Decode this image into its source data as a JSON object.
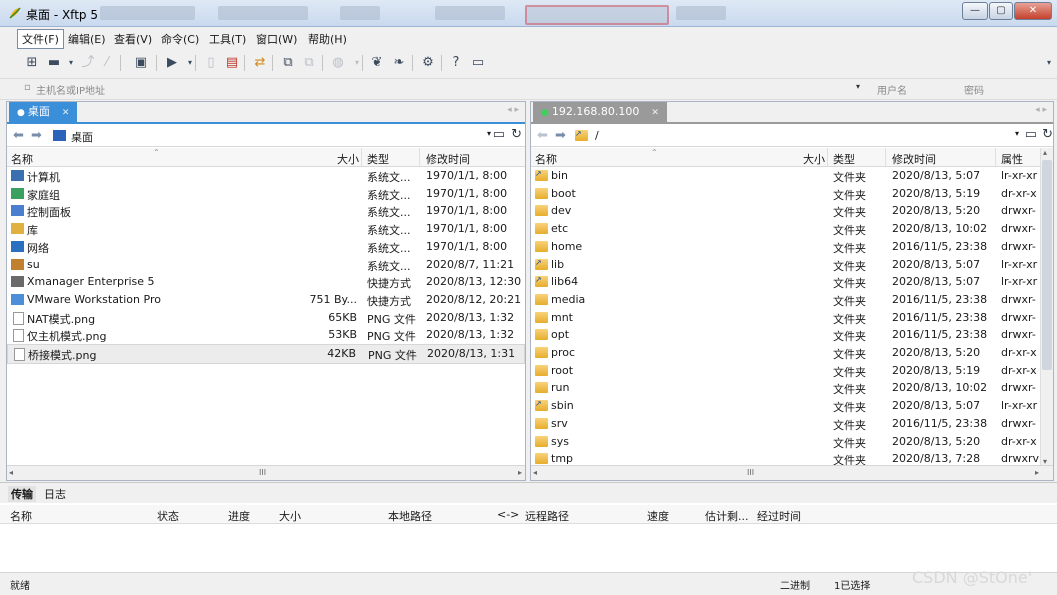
{
  "window": {
    "title": "桌面 - Xftp 5",
    "minimize": "—",
    "maximize": "▢",
    "close": "✕"
  },
  "menu": [
    "文件(F)",
    "编辑(E)",
    "查看(V)",
    "命令(C)",
    "工具(T)",
    "窗口(W)",
    "帮助(H)"
  ],
  "address": {
    "host_placeholder": "主机名或IP地址",
    "user_placeholder": "用户名",
    "password_placeholder": "密码"
  },
  "left_pane": {
    "tab_label": "桌面",
    "path": "桌面",
    "columns": {
      "name": "名称",
      "size": "大小",
      "type": "类型",
      "modified": "修改时间"
    },
    "rows": [
      {
        "name": "计算机",
        "size": "",
        "type": "系统文...",
        "modified": "1970/1/1, 8:00",
        "icon": "computer-icon"
      },
      {
        "name": "家庭组",
        "size": "",
        "type": "系统文...",
        "modified": "1970/1/1, 8:00",
        "icon": "homegroup-icon"
      },
      {
        "name": "控制面板",
        "size": "",
        "type": "系统文...",
        "modified": "1970/1/1, 8:00",
        "icon": "control-panel-icon"
      },
      {
        "name": "库",
        "size": "",
        "type": "系统文...",
        "modified": "1970/1/1, 8:00",
        "icon": "library-icon"
      },
      {
        "name": "网络",
        "size": "",
        "type": "系统文...",
        "modified": "1970/1/1, 8:00",
        "icon": "network-icon"
      },
      {
        "name": "su",
        "size": "",
        "type": "系统文...",
        "modified": "2020/8/7, 11:21",
        "icon": "user-icon"
      },
      {
        "name": "Xmanager Enterprise 5",
        "size": "",
        "type": "快捷方式",
        "modified": "2020/8/13, 12:30",
        "icon": "shortcut-icon"
      },
      {
        "name": "VMware Workstation Pro",
        "size": "751 By...",
        "type": "快捷方式",
        "modified": "2020/8/12, 20:21",
        "icon": "vmware-icon"
      },
      {
        "name": "NAT模式.png",
        "size": "65KB",
        "type": "PNG 文件",
        "modified": "2020/8/13, 1:32",
        "icon": "image-file-icon"
      },
      {
        "name": "仅主机模式.png",
        "size": "53KB",
        "type": "PNG 文件",
        "modified": "2020/8/13, 1:32",
        "icon": "image-file-icon"
      },
      {
        "name": "桥接模式.png",
        "size": "42KB",
        "type": "PNG 文件",
        "modified": "2020/8/13, 1:31",
        "icon": "image-file-icon"
      }
    ],
    "selected_index": 10,
    "hscroll_grip": "III"
  },
  "right_pane": {
    "tab_label": "192.168.80.100",
    "path": "/",
    "columns": {
      "name": "名称",
      "size": "大小",
      "type": "类型",
      "modified": "修改时间",
      "attrs": "属性"
    },
    "rows": [
      {
        "name": "bin",
        "type": "文件夹",
        "modified": "2020/8/13, 5:07",
        "attrs": "lr-xr-xr",
        "link": true
      },
      {
        "name": "boot",
        "type": "文件夹",
        "modified": "2020/8/13, 5:19",
        "attrs": "dr-xr-x",
        "link": false
      },
      {
        "name": "dev",
        "type": "文件夹",
        "modified": "2020/8/13, 5:20",
        "attrs": "drwxr-",
        "link": false
      },
      {
        "name": "etc",
        "type": "文件夹",
        "modified": "2020/8/13, 10:02",
        "attrs": "drwxr-",
        "link": false
      },
      {
        "name": "home",
        "type": "文件夹",
        "modified": "2016/11/5, 23:38",
        "attrs": "drwxr-",
        "link": false
      },
      {
        "name": "lib",
        "type": "文件夹",
        "modified": "2020/8/13, 5:07",
        "attrs": "lr-xr-xr",
        "link": true
      },
      {
        "name": "lib64",
        "type": "文件夹",
        "modified": "2020/8/13, 5:07",
        "attrs": "lr-xr-xr",
        "link": true
      },
      {
        "name": "media",
        "type": "文件夹",
        "modified": "2016/11/5, 23:38",
        "attrs": "drwxr-",
        "link": false
      },
      {
        "name": "mnt",
        "type": "文件夹",
        "modified": "2016/11/5, 23:38",
        "attrs": "drwxr-",
        "link": false
      },
      {
        "name": "opt",
        "type": "文件夹",
        "modified": "2016/11/5, 23:38",
        "attrs": "drwxr-",
        "link": false
      },
      {
        "name": "proc",
        "type": "文件夹",
        "modified": "2020/8/13, 5:20",
        "attrs": "dr-xr-x",
        "link": false
      },
      {
        "name": "root",
        "type": "文件夹",
        "modified": "2020/8/13, 5:19",
        "attrs": "dr-xr-x",
        "link": false
      },
      {
        "name": "run",
        "type": "文件夹",
        "modified": "2020/8/13, 10:02",
        "attrs": "drwxr-",
        "link": false
      },
      {
        "name": "sbin",
        "type": "文件夹",
        "modified": "2020/8/13, 5:07",
        "attrs": "lr-xr-xr",
        "link": true
      },
      {
        "name": "srv",
        "type": "文件夹",
        "modified": "2016/11/5, 23:38",
        "attrs": "drwxr-",
        "link": false
      },
      {
        "name": "sys",
        "type": "文件夹",
        "modified": "2020/8/13, 5:20",
        "attrs": "dr-xr-x",
        "link": false
      },
      {
        "name": "tmp",
        "type": "文件夹",
        "modified": "2020/8/13, 7:28",
        "attrs": "drwxrv",
        "link": false
      }
    ],
    "hscroll_grip": "III"
  },
  "transfer": {
    "tabs": [
      "传输",
      "日志"
    ],
    "columns": [
      "名称",
      "状态",
      "进度",
      "大小",
      "本地路径",
      "<->",
      "远程路径",
      "速度",
      "估计剩...",
      "经过时间"
    ]
  },
  "status": {
    "left": "就绪",
    "mode": "二进制",
    "selection": "1已选择"
  },
  "watermark": "CSDN @StOne'"
}
